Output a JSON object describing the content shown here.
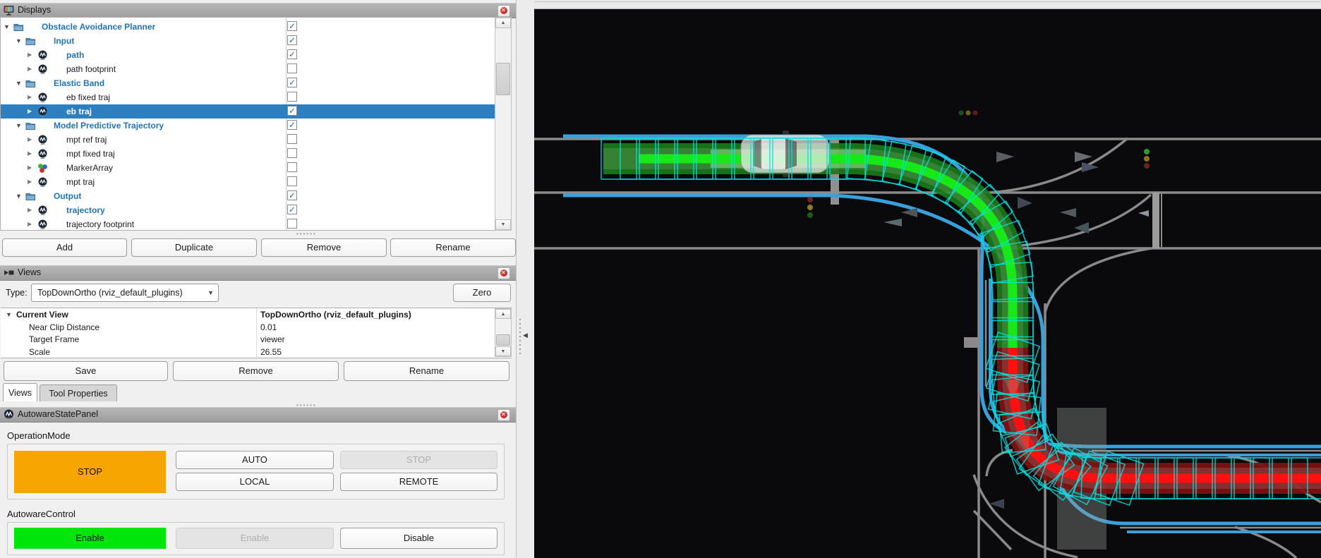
{
  "displays_panel": {
    "title": "Displays",
    "tree": [
      {
        "label": "Obstacle Avoidance Planner",
        "depth": 0,
        "kind": "folder",
        "style": "blue",
        "checked": true
      },
      {
        "label": "Input",
        "depth": 1,
        "kind": "folder",
        "style": "blue",
        "checked": true
      },
      {
        "label": "path",
        "depth": 2,
        "kind": "autoware",
        "style": "blue",
        "checked": true
      },
      {
        "label": "path footprint",
        "depth": 2,
        "kind": "autoware",
        "style": "plain",
        "checked": false
      },
      {
        "label": "Elastic Band",
        "depth": 1,
        "kind": "folder",
        "style": "blue",
        "checked": true
      },
      {
        "label": "eb fixed traj",
        "depth": 2,
        "kind": "autoware",
        "style": "plain",
        "checked": false
      },
      {
        "label": "eb traj",
        "depth": 2,
        "kind": "autoware",
        "style": "selected",
        "checked": true,
        "selected": true
      },
      {
        "label": "Model Predictive Trajectory",
        "depth": 1,
        "kind": "folder",
        "style": "blue",
        "checked": true
      },
      {
        "label": "mpt ref traj",
        "depth": 2,
        "kind": "autoware",
        "style": "plain",
        "checked": false
      },
      {
        "label": "mpt fixed traj",
        "depth": 2,
        "kind": "autoware",
        "style": "plain",
        "checked": false
      },
      {
        "label": "MarkerArray",
        "depth": 2,
        "kind": "marker",
        "style": "plain",
        "checked": false
      },
      {
        "label": "mpt traj",
        "depth": 2,
        "kind": "autoware",
        "style": "plain",
        "checked": false
      },
      {
        "label": "Output",
        "depth": 1,
        "kind": "folder",
        "style": "blue",
        "checked": true
      },
      {
        "label": "trajectory",
        "depth": 2,
        "kind": "autoware",
        "style": "blue",
        "checked": true
      },
      {
        "label": "trajectory footprint",
        "depth": 2,
        "kind": "autoware",
        "style": "plain",
        "checked": false
      }
    ],
    "buttons": [
      "Add",
      "Duplicate",
      "Remove",
      "Rename"
    ]
  },
  "views_panel": {
    "title": "Views",
    "type_label": "Type:",
    "type_value": "TopDownOrtho (rviz_default_plugins)",
    "zero_button": "Zero",
    "properties": [
      {
        "name": "Current View",
        "value": "TopDownOrtho (rviz_default_plugins)",
        "header": true
      },
      {
        "name": "Near Clip Distance",
        "value": "0.01"
      },
      {
        "name": "Target Frame",
        "value": "viewer"
      },
      {
        "name": "Scale",
        "value": "26.55"
      }
    ],
    "buttons": [
      "Save",
      "Remove",
      "Rename"
    ],
    "tabs": [
      {
        "label": "Views",
        "active": true
      },
      {
        "label": "Tool Properties",
        "active": false
      }
    ]
  },
  "state_panel": {
    "title": "AutowareStatePanel",
    "operation_mode": {
      "label": "OperationMode",
      "indicator": {
        "text": "STOP",
        "color": "#f7a500"
      },
      "buttons": [
        {
          "label": "AUTO",
          "enabled": true
        },
        {
          "label": "STOP",
          "enabled": false
        },
        {
          "label": "LOCAL",
          "enabled": true
        },
        {
          "label": "REMOTE",
          "enabled": true
        }
      ]
    },
    "autoware_control": {
      "label": "AutowareControl",
      "indicator": {
        "text": "Enable",
        "color": "#00e60a"
      },
      "buttons": [
        {
          "label": "Enable",
          "enabled": false
        },
        {
          "label": "Disable",
          "enabled": true
        }
      ]
    }
  },
  "viewport": {
    "scene": "top-down ortho view of ego vehicle following a 90-degree right-turn route through two intersections",
    "colors": {
      "background": "#0a0a0c",
      "road_line": "#8a8a8a",
      "lane_boundary_blue": "#38a0dc",
      "trajectory_green_band": "#1a7a1a",
      "trajectory_green_line": "#17e817",
      "trajectory_red_band": "#7a1212",
      "trajectory_red_line": "#ff1010",
      "footprint_box_cyan": "#00e1e1",
      "building_overlay": "#949c94"
    },
    "traffic_lights": [
      {
        "position": "near-ego-stop-line",
        "dots": [
          "dim-red",
          "dim-yellow",
          "dim-green"
        ]
      },
      {
        "position": "cross-street",
        "dots": [
          "green",
          "dim-yellow",
          "dim-red"
        ]
      },
      {
        "position": "far-intersection",
        "dots": [
          "dim-green",
          "dim-yellow",
          "dim-red"
        ]
      }
    ]
  }
}
